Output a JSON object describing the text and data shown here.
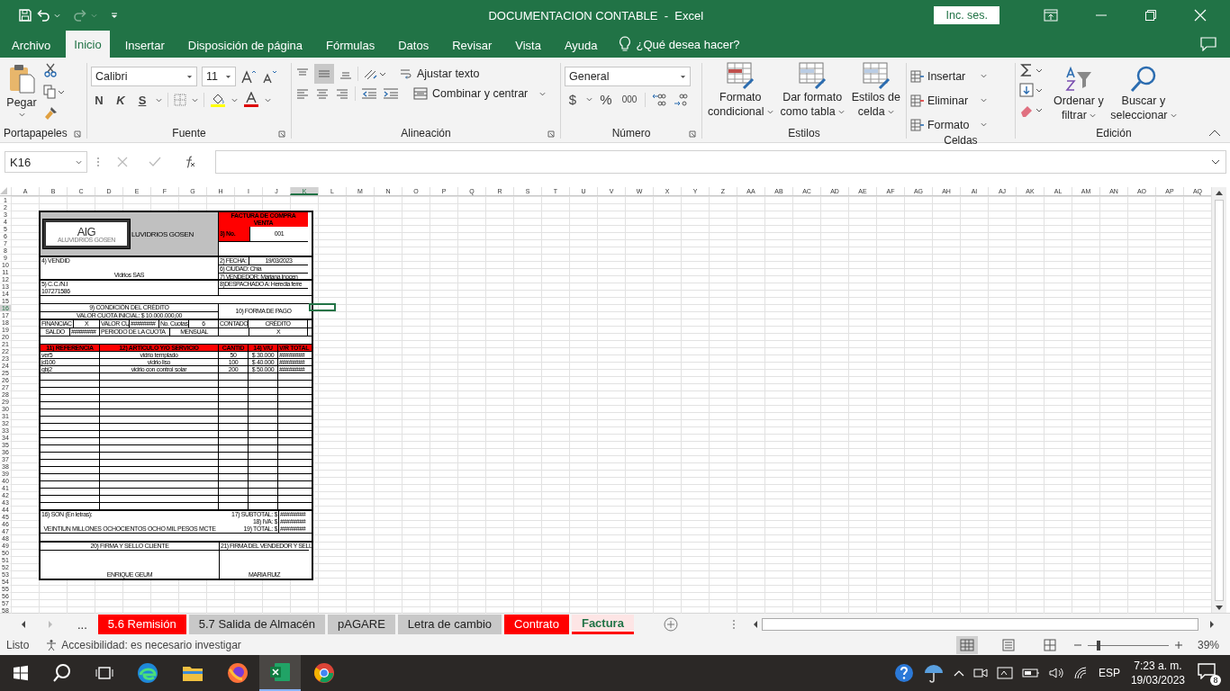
{
  "window": {
    "title": "DOCUMENTACION CONTABLE  -  Excel",
    "sign_in": "Inc. ses."
  },
  "menu_tabs": [
    {
      "label": "Archivo",
      "selected": false
    },
    {
      "label": "Inicio",
      "selected": true
    },
    {
      "label": "Insertar",
      "selected": false
    },
    {
      "label": "Disposición de página",
      "selected": false
    },
    {
      "label": "Fórmulas",
      "selected": false
    },
    {
      "label": "Datos",
      "selected": false
    },
    {
      "label": "Revisar",
      "selected": false
    },
    {
      "label": "Vista",
      "selected": false
    },
    {
      "label": "Ayuda",
      "selected": false
    }
  ],
  "tell_me": "¿Qué desea hacer?",
  "clipboard": {
    "paste": "Pegar",
    "label": "Portapapeles"
  },
  "font": {
    "name": "Calibri",
    "size": "11",
    "bold": "N",
    "italic": "K",
    "underline": "S",
    "label": "Fuente"
  },
  "alignment": {
    "wrap": "Ajustar texto",
    "merge": "Combinar y centrar",
    "label": "Alineación"
  },
  "number": {
    "format": "General",
    "currency": "$",
    "percent": "%",
    "thousands": "000",
    "label": "Número"
  },
  "styles": {
    "buttons": [
      [
        "Formato",
        "condicional"
      ],
      [
        "Dar formato",
        "como tabla"
      ],
      [
        "Estilos de",
        "celda"
      ]
    ],
    "label": "Estilos"
  },
  "cells": {
    "buttons": [
      "Insertar",
      "Eliminar",
      "Formato"
    ],
    "label": "Celdas"
  },
  "editing": {
    "sort": [
      "Ordenar y",
      "filtrar"
    ],
    "find": [
      "Buscar y",
      "seleccionar"
    ],
    "label": "Edición"
  },
  "formula_bar": {
    "name_box": "K16"
  },
  "sheet": {
    "columns": [
      "A",
      "B",
      "C",
      "D",
      "E",
      "F",
      "G",
      "H",
      "I",
      "J",
      "K",
      "L",
      "M",
      "N",
      "O",
      "P",
      "Q",
      "R",
      "S",
      "T",
      "U",
      "V",
      "W",
      "X",
      "Y",
      "Z",
      "AA",
      "AB",
      "AC",
      "AD",
      "AE",
      "AF",
      "AG",
      "AH",
      "AI",
      "AJ",
      "AK",
      "AL",
      "AM",
      "AN",
      "AO",
      "AP",
      "AQ"
    ],
    "rows": [
      "1",
      "2",
      "3",
      "4",
      "5",
      "6",
      "7",
      "8",
      "9",
      "10",
      "11",
      "12",
      "13",
      "14",
      "15",
      "16",
      "17",
      "18",
      "19",
      "20",
      "21",
      "22",
      "23",
      "24",
      "25",
      "26",
      "27",
      "28",
      "29",
      "30",
      "31",
      "32",
      "33",
      "34",
      "35",
      "36",
      "37",
      "38",
      "39",
      "40",
      "41",
      "42",
      "43",
      "44",
      "45",
      "46",
      "47",
      "48",
      "49",
      "50",
      "51",
      "52",
      "53",
      "54",
      "55",
      "56",
      "57",
      "58"
    ]
  },
  "invoice": {
    "title": "FACTURA DE COMPRA VENTA",
    "logo_mark": "AlG",
    "logo_name": "ALUVIDRIOS GOSEN",
    "company": "LUVIDRIOS GOSEN",
    "number_label": "3) No.",
    "number": "001",
    "seller_label": "4) VENDID",
    "seller": "Vidrios SAS",
    "date_label": "2) FECHA:",
    "date": "19/03/2023",
    "city": "6) CIUDAD: Chía",
    "salesperson": "7) VENDEDOR: Mariana Inocen",
    "id_label": "5) C.C./N.I",
    "id": "107271586",
    "ship_to": "8)DESPACHADO A: Heredia ferre",
    "credit_title": "9) CONDICIÓN DEL CRÉDITO",
    "down_payment": "VALOR CUOTA INICIAL: $ 10.000.000,00",
    "payment_title": "10) FORMA DE PAGO",
    "row_17": [
      "FINANCIAC",
      "X",
      "VALOR CU",
      "########",
      "No. Cuotas",
      "6",
      "CONTADO",
      "CRÉDITO"
    ],
    "row_18": [
      "SALDO",
      "########",
      "PERIODO DE LA CUOTA",
      "MENSUAL",
      "X"
    ],
    "columns": [
      "11) REFERENCIA",
      "12) ARTÍCULO Y/O SERVICIO",
      "CANTID",
      "14) V/U",
      "V/R TOTAL"
    ],
    "items": [
      {
        "ref": "ver5",
        "article": "vidrio templado",
        "qty": "50",
        "unit": "$ 30.000",
        "total": "########"
      },
      {
        "ref": "jd100",
        "article": "vidrio liso",
        "qty": "100",
        "unit": "$ 40.000",
        "total": "########"
      },
      {
        "ref": "gbj2",
        "article": "vidrio con control solar",
        "qty": "200",
        "unit": "$ 50.000",
        "total": "########"
      }
    ],
    "words_label": "16) SON (En letras):",
    "words": "VEINTIUN MILLONES OCHOCIENTOS OCHO MIL PESOS MCTE",
    "totals": [
      {
        "label": "17) SUBTOTAL: $",
        "value": "########"
      },
      {
        "label": "18) IVA: $",
        "value": "########"
      },
      {
        "label": "19) TOTAL: $",
        "value": "########"
      }
    ],
    "signatures": [
      {
        "label": "20) FIRMA Y SELLO CLIENTE",
        "name": "ENRIQUE GEUM"
      },
      {
        "label": "21) FIRMA DEL VENDEDOR Y SELL",
        "name": "MARIA RUIZ"
      }
    ]
  },
  "sheet_tabs": {
    "more": "...",
    "tabs": [
      {
        "label": "5.6 Remisión",
        "selected": false,
        "color": "#ff0000"
      },
      {
        "label": "5.7 Salida de Almacén",
        "selected": false,
        "color": "#c8c8c8"
      },
      {
        "label": "pAGARE",
        "selected": false,
        "color": "#c8c8c8"
      },
      {
        "label": "Letra de cambio",
        "selected": false,
        "color": "#c8c8c8"
      },
      {
        "label": "Contrato",
        "selected": false,
        "color": "#ff0000"
      },
      {
        "label": "Factura",
        "selected": true,
        "color": "#ff0000"
      }
    ]
  },
  "status_bar": {
    "ready": "Listo",
    "accessibility": "Accesibilidad: es necesario investigar",
    "zoom": "39%",
    "level": 0.13
  },
  "taskbar": {
    "lang": "ESP",
    "time": "7:23 a. m.",
    "date": "19/03/2023",
    "notifications": "8"
  }
}
